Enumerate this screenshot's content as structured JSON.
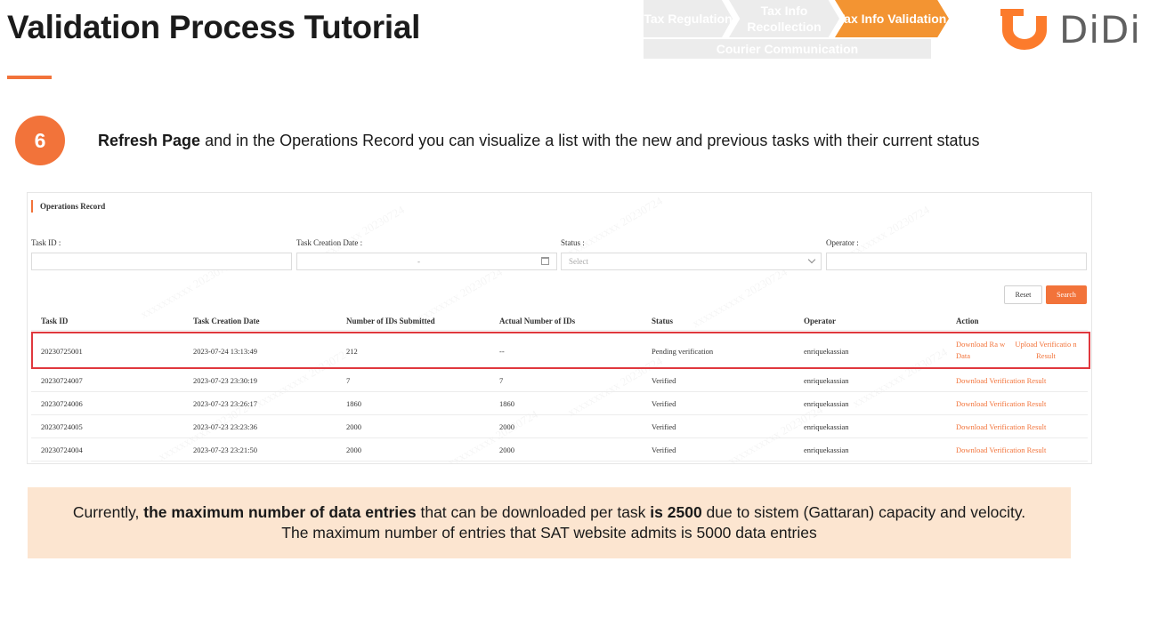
{
  "header": {
    "title": "Validation Process Tutorial",
    "breadcrumb": {
      "steps": [
        "Tax Regulation",
        "Tax Info Recollection",
        "Tax Info Validation"
      ],
      "active_index": 2,
      "bottom_bar": "Courier Communication"
    },
    "logo_text": "DiDi"
  },
  "step": {
    "number": "6",
    "text_bold": "Refresh Page",
    "text_rest": " and in the Operations Record you can visualize a list with the new and previous tasks with their current status"
  },
  "panel": {
    "title": "Operations Record",
    "filters": {
      "task_id_label": "Task ID :",
      "date_label": "Task Creation Date :",
      "date_separator": "-",
      "status_label": "Status :",
      "status_placeholder": "Select",
      "operator_label": "Operator :"
    },
    "buttons": {
      "reset": "Reset",
      "search": "Search"
    },
    "columns": [
      "Task ID",
      "Task Creation Date",
      "Number of IDs Submitted",
      "Actual Number of IDs",
      "Status",
      "Operator",
      "Action"
    ],
    "rows": [
      {
        "task_id": "20230725001",
        "date": "2023-07-24 13:13:49",
        "submitted": "212",
        "actual": "--",
        "status": "Pending verification",
        "operator": "enriquekassian",
        "action_1": "Download Ra w Data",
        "action_2": "Upload Verificatio n Result"
      },
      {
        "task_id": "20230724007",
        "date": "2023-07-23 23:30:19",
        "submitted": "7",
        "actual": "7",
        "status": "Verified",
        "operator": "enriquekassian",
        "action_1": "Download Verification Result"
      },
      {
        "task_id": "20230724006",
        "date": "2023-07-23 23:26:17",
        "submitted": "1860",
        "actual": "1860",
        "status": "Verified",
        "operator": "enriquekassian",
        "action_1": "Download Verification Result"
      },
      {
        "task_id": "20230724005",
        "date": "2023-07-23 23:23:36",
        "submitted": "2000",
        "actual": "2000",
        "status": "Verified",
        "operator": "enriquekassian",
        "action_1": "Download Verification Result"
      },
      {
        "task_id": "20230724004",
        "date": "2023-07-23 23:21:50",
        "submitted": "2000",
        "actual": "2000",
        "status": "Verified",
        "operator": "enriquekassian",
        "action_1": "Download Verification Result"
      }
    ]
  },
  "note": {
    "line1_a": "Currently, ",
    "line1_b": "the maximum number of data entries",
    "line1_c": " that can be downloaded per task ",
    "line1_d": "is 2500",
    "line1_e": " due to sistem (Gattaran) capacity and velocity.",
    "line2": "The maximum number of entries that SAT website admits is 5000 data entries"
  },
  "colors": {
    "accent": "#f2733a",
    "breadcrumb_active": "#f39432",
    "highlight": "#e0383e",
    "note_bg": "#fce5d0"
  }
}
